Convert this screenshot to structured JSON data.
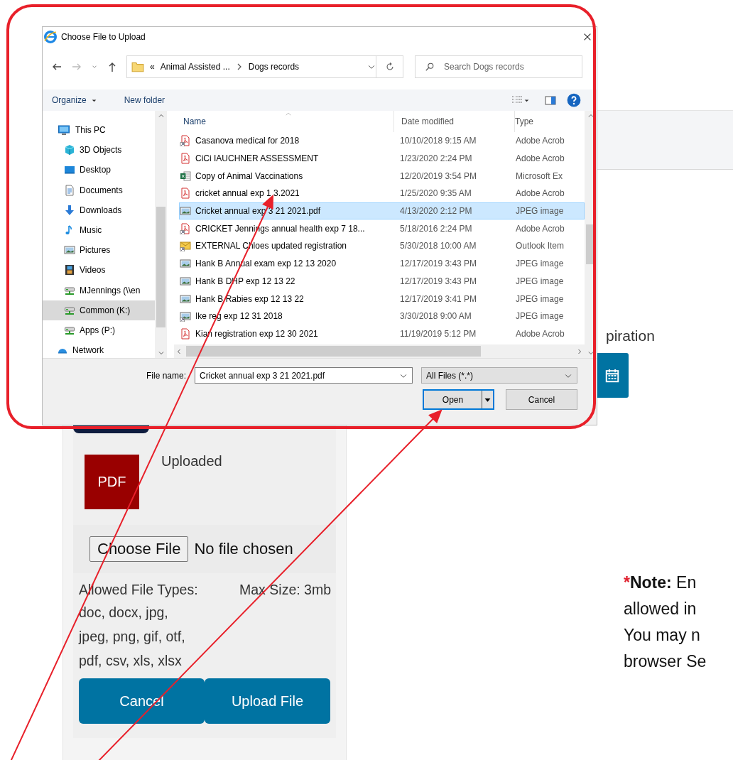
{
  "dialog": {
    "title": "Choose File to Upload",
    "path_prefix": "«",
    "path": [
      "Animal Assisted ...",
      "Dogs records"
    ],
    "search": {
      "placeholder": "Search Dogs records"
    },
    "toolbar": [
      {
        "label": "Organize",
        "kind": "menu"
      },
      {
        "label": "New folder",
        "kind": "button"
      }
    ],
    "nav": [
      {
        "label": "This PC",
        "kind": "pc",
        "selected": false,
        "children": [
          {
            "label": "3D Objects",
            "kind": "cube",
            "selected": false
          },
          {
            "label": "Desktop",
            "kind": "desktop",
            "selected": false
          },
          {
            "label": "Documents",
            "kind": "documents",
            "selected": false
          },
          {
            "label": "Downloads",
            "kind": "downloads",
            "selected": false
          },
          {
            "label": "Music",
            "kind": "music",
            "selected": false
          },
          {
            "label": "Pictures",
            "kind": "pictures",
            "selected": false
          },
          {
            "label": "Videos",
            "kind": "videos",
            "selected": false
          },
          {
            "label": "MJennings (\\\\en",
            "kind": "drive",
            "selected": false
          },
          {
            "label": "Common (K:)",
            "kind": "drive",
            "selected": true
          },
          {
            "label": "Apps (P:)",
            "kind": "drive",
            "selected": false
          }
        ]
      },
      {
        "label": "Network",
        "kind": "network",
        "selected": false
      }
    ],
    "columns": [
      "Name",
      "Date modified",
      "Type"
    ],
    "files": [
      {
        "name": "Casanova medical for 2018",
        "date": "10/10/2018 9:15 AM",
        "type": "Adobe Acrob",
        "kind": "pdf-link",
        "selected": false
      },
      {
        "name": "CiCi IAUCHNER ASSESSMENT",
        "date": "1/23/2020 2:24 PM",
        "type": "Adobe Acrob",
        "kind": "pdf",
        "selected": false
      },
      {
        "name": "Copy of Animal Vaccinations",
        "date": "12/20/2019 3:54 PM",
        "type": "Microsoft Ex",
        "kind": "excel",
        "selected": false
      },
      {
        "name": "cricket annual exp 1 3.2021",
        "date": "1/25/2020 9:35 AM",
        "type": "Adobe Acrob",
        "kind": "pdf",
        "selected": false
      },
      {
        "name": "Cricket annual exp 3 21 2021.pdf",
        "date": "4/13/2020 2:12 PM",
        "type": "JPEG image",
        "kind": "image",
        "selected": true
      },
      {
        "name": "CRICKET Jennings annual health exp 7 18...",
        "date": "5/18/2016 2:24 PM",
        "type": "Adobe Acrob",
        "kind": "pdf-link",
        "selected": false
      },
      {
        "name": "EXTERNAL Chloes updated registration",
        "date": "5/30/2018 10:00 AM",
        "type": "Outlook Item",
        "kind": "mail-link",
        "selected": false
      },
      {
        "name": "Hank B Annual exam exp 12 13 2020",
        "date": "12/17/2019 3:43 PM",
        "type": "JPEG image",
        "kind": "image",
        "selected": false
      },
      {
        "name": "Hank B DHP exp 12 13 22",
        "date": "12/17/2019 3:43 PM",
        "type": "JPEG image",
        "kind": "image",
        "selected": false
      },
      {
        "name": "Hank B Rabies exp 12 13 22",
        "date": "12/17/2019 3:41 PM",
        "type": "JPEG image",
        "kind": "image",
        "selected": false
      },
      {
        "name": "Ike reg exp 12 31 2018",
        "date": "3/30/2018 9:00 AM",
        "type": "JPEG image",
        "kind": "image-link",
        "selected": false
      },
      {
        "name": "Kian registration exp 12 30 2021",
        "date": "11/19/2019 5:12 PM",
        "type": "Adobe Acrob",
        "kind": "pdf",
        "selected": false
      }
    ],
    "file_name_label": "File name:",
    "file_name": "Cricket annual exp 3 21 2021.pdf",
    "filter": "All Files (*.*)",
    "buttons": [
      {
        "label": "Open",
        "kind": "split",
        "selected": true
      },
      {
        "label": "Cancel",
        "kind": "plain",
        "selected": false
      }
    ]
  },
  "upload": {
    "badge": "PDF",
    "status": "Uploaded",
    "choose_button": "Choose File",
    "no_file": "No file chosen",
    "allowed_label": "Allowed File Types:",
    "max_size": "Max Size: 3mb",
    "types": [
      "doc, docx, jpg,",
      "jpeg, png, gif, otf,",
      "pdf, csv, xls, xlsx"
    ],
    "buttons": [
      "Cancel",
      "Upload File"
    ]
  },
  "right": {
    "label_fragment": "piration",
    "note_marker": "*",
    "note_lines": [
      "**Note:**  En",
      "allowed in",
      "You may n",
      "browser Se"
    ]
  },
  "annotations": [
    {
      "kind": "outline"
    },
    {
      "kind": "arrow"
    },
    {
      "kind": "arrow"
    }
  ]
}
